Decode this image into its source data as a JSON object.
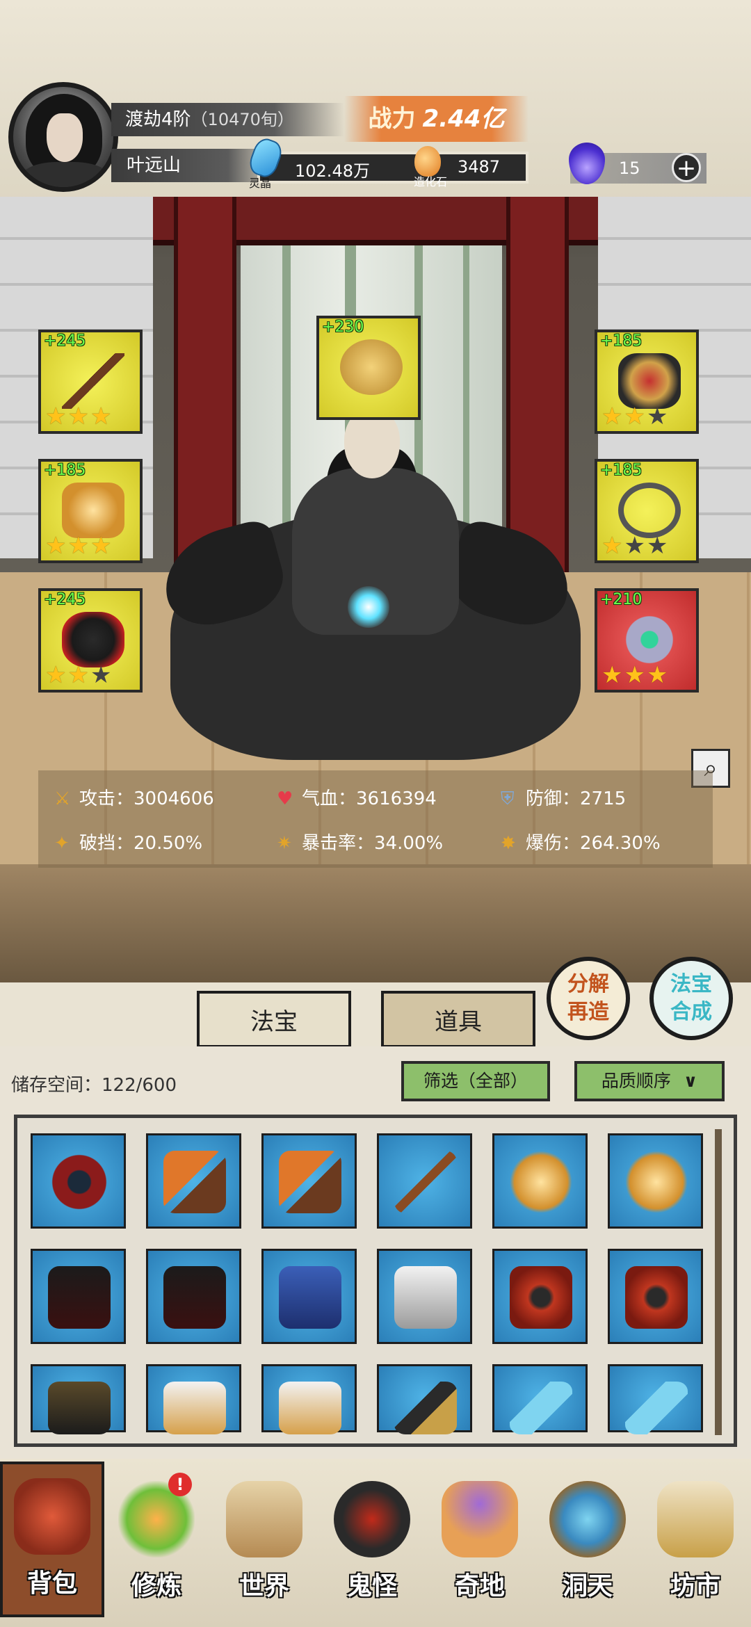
{
  "player": {
    "realm": "渡劫4阶",
    "realm_progress": "（10470旬）",
    "name": "叶远山",
    "power_label": "战力",
    "power_value": "2.44亿"
  },
  "resources": {
    "lingjing_value": "102.48万",
    "lingjing_label": "灵晶",
    "zaohua_value": "3487",
    "zaohua_label": "造化石",
    "soul_value": "15",
    "add_label": "+"
  },
  "equipment": {
    "slots": [
      {
        "bonus": "+245",
        "stars": 3,
        "max": 3,
        "color": "yellow"
      },
      {
        "bonus": "+230",
        "stars": 0,
        "max": 0,
        "color": "yellow"
      },
      {
        "bonus": "+185",
        "stars": 2,
        "max": 3,
        "color": "yellow"
      },
      {
        "bonus": "+185",
        "stars": 3,
        "max": 3,
        "color": "yellow"
      },
      {
        "bonus": "+185",
        "stars": 1,
        "max": 3,
        "color": "yellow"
      },
      {
        "bonus": "+245",
        "stars": 2,
        "max": 3,
        "color": "yellow"
      },
      {
        "bonus": "+210",
        "stars": 3,
        "max": 3,
        "color": "red"
      }
    ]
  },
  "stats": {
    "attack": "攻击：3004606",
    "hp": "气血：3616394",
    "defense": "防御：2715",
    "break": "破挡：20.50%",
    "crit_rate": "暴击率：34.00%",
    "crit_damage": "爆伤：264.30%"
  },
  "actions": {
    "decompose": [
      "分解",
      "再造"
    ],
    "synthesize": [
      "法宝",
      "合成"
    ]
  },
  "tabs": {
    "fabao": "法宝",
    "daoju": "道具"
  },
  "inventory": {
    "storage": "储存空间：122/600",
    "filter": "筛选（全部）",
    "sort": "品质顺序",
    "sort_icon": "chevron-down-icon"
  },
  "nav": {
    "items": [
      "背包",
      "修炼",
      "世界",
      "鬼怪",
      "奇地",
      "洞天",
      "坊市"
    ],
    "badge": "!"
  },
  "colors": {
    "accent_orange": "#e6823e",
    "slot_yellow": "#f4f15a",
    "slot_red": "#d94040",
    "cell_blue": "#3a98d0",
    "bonus_green": "#6cff4d"
  }
}
